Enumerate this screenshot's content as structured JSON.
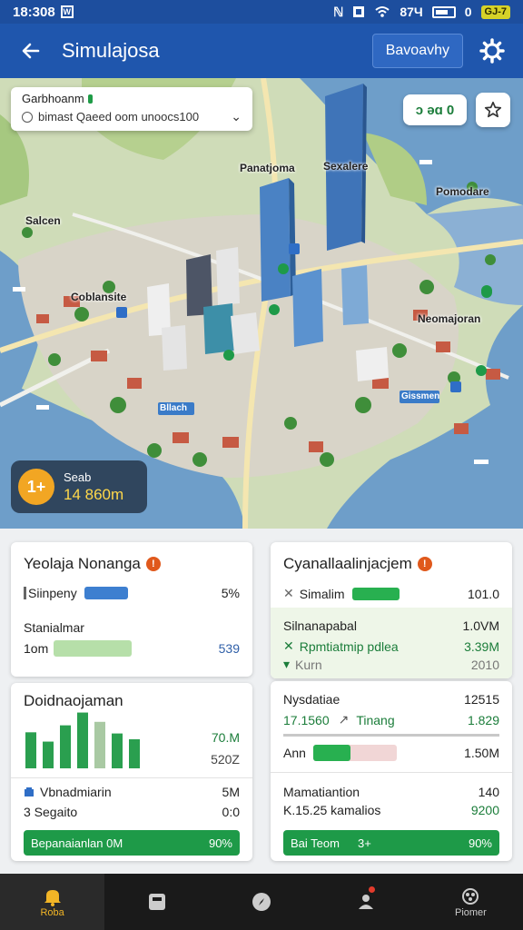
{
  "status_bar": {
    "time": "18:308",
    "square": "W",
    "right_text": "ℕ",
    "wifi_text": "87Ч",
    "battery_zero": "0",
    "battery_badge": "GJ-7"
  },
  "app_bar": {
    "title": "Simulajosa",
    "action_label": "Bavoavhy"
  },
  "map": {
    "search": {
      "title": "Garbhoanm",
      "subtitle": "bimast Qaeed oom unoocs100"
    },
    "chip_label": "ɔ əɑ 0",
    "labels": {
      "panatjoma": "Panatjoma",
      "sexalere": "Sexalere",
      "pomodare": "Pomodare",
      "salcen": "Salcen",
      "coblansite": "Coblansite",
      "neomajoran": "Neomajoran",
      "bottom_a": "Bllach",
      "bottom_b": "Gissmen"
    },
    "stat": {
      "icon_text": "1+",
      "label": "Seab",
      "value": "14 860m"
    }
  },
  "card_left_top": {
    "title": "Yeolaja Nonanga",
    "row1": {
      "label": "Siinpeny",
      "value": "5%"
    },
    "row2_label": "Stanialmar",
    "row3": {
      "label": "1om",
      "value": "539"
    }
  },
  "card_left_bottom": {
    "title": "Doidnaojaman",
    "bar_values": [
      0.62,
      0.46,
      0.74,
      0.96,
      0.8,
      0.6,
      0.5
    ],
    "value1": "70.M",
    "value2": "520Z",
    "row1": {
      "label": "Vbnadmiarin",
      "value": "5M"
    },
    "row2": {
      "label": "3 Segaito",
      "value": "0:0"
    },
    "strip": {
      "label": "Bepanaianlan  0M",
      "value": "90%"
    }
  },
  "card_right_top": {
    "title": "Cyanallaalinjacjem",
    "row1": {
      "label": "Simalim",
      "value": "101.0"
    },
    "row2": {
      "label": "Silnanapabal",
      "value": "1.0VM"
    },
    "row3": {
      "label": "Rpmtiatmip pdlea",
      "value": "3.39M"
    },
    "row4": {
      "label": "Kurn",
      "value": "2010"
    }
  },
  "card_right_bottom": {
    "row1": {
      "label": "Nysdatiae",
      "value": "12515"
    },
    "row2": {
      "label": "17.1560",
      "mid": "Tinang",
      "value": "1.829"
    },
    "row3": {
      "label": "Ann",
      "value": "1.50M"
    },
    "row4": {
      "label": "Mamatiantion",
      "value": "140"
    },
    "row5": {
      "label": "K.15.25 kamalios",
      "value": "9200"
    },
    "strip": {
      "label": "Bai Teom",
      "mid": "3+",
      "value": "90%"
    }
  },
  "bottom_nav": {
    "items": [
      {
        "label": "Roba"
      },
      {
        "label": ""
      },
      {
        "label": ""
      },
      {
        "label": ""
      },
      {
        "label": "Piomer"
      }
    ]
  },
  "colors": {
    "primary": "#1f56ad",
    "green": "#1e9a48",
    "blue_bar": "#3d7fd0",
    "accent": "#f2b526"
  }
}
